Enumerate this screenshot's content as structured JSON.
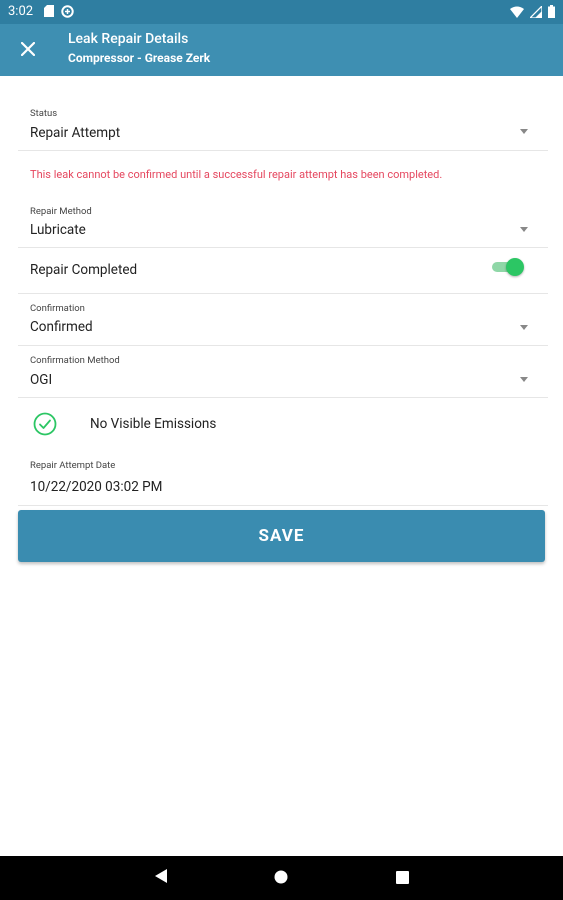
{
  "status_bar": {
    "time": "3:02",
    "icons": [
      "sd-card-icon",
      "data-saver-icon",
      "wifi-icon",
      "signal-icon",
      "battery-icon"
    ]
  },
  "app_bar": {
    "title": "Leak Repair Details",
    "subtitle": "Compressor - Grease Zerk",
    "close_icon": "close-icon"
  },
  "form": {
    "status": {
      "label": "Status",
      "value": "Repair Attempt"
    },
    "error_message": "This leak cannot be confirmed until a successful repair attempt has been completed.",
    "repair_method": {
      "label": "Repair Method",
      "value": "Lubricate"
    },
    "repair_completed": {
      "label": "Repair Completed",
      "on": true
    },
    "confirmation": {
      "label": "Confirmation",
      "value": "Confirmed"
    },
    "confirmation_method": {
      "label": "Confirmation Method",
      "value": "OGI"
    },
    "no_visible_emissions": {
      "label": "No Visible Emissions",
      "checked": true
    },
    "repair_attempt_date": {
      "label": "Repair Attempt Date",
      "value": "10/22/2020 03:02 PM"
    }
  },
  "save_button": {
    "label": "SAVE"
  },
  "nav_bar": {
    "icons": [
      "back-icon",
      "home-icon",
      "recents-icon"
    ]
  },
  "colors": {
    "status_bar": "#2f7ea1",
    "app_bar": "#3e8fb2",
    "save_button": "#3a8cb0",
    "error": "#e5475f",
    "toggle_on": "#2cc664"
  }
}
